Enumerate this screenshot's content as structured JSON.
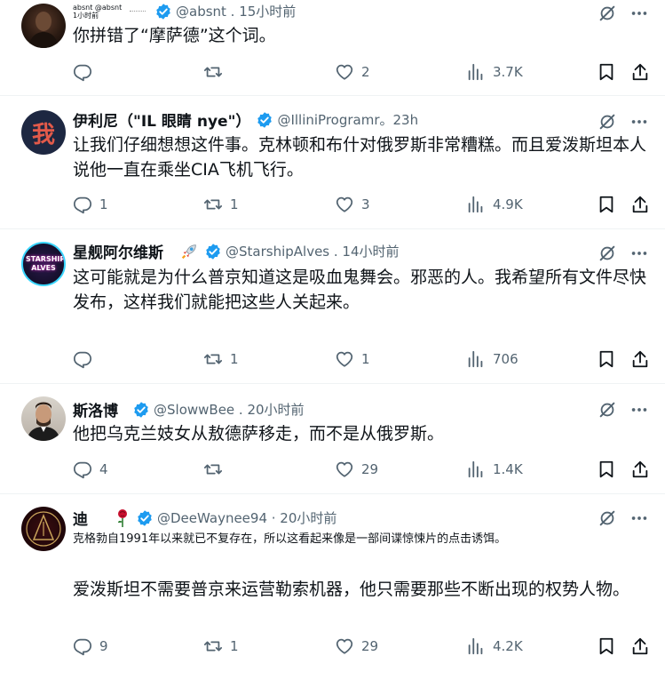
{
  "tweets": [
    {
      "name": "absnt @absnt 1小时前",
      "handle": "@absnt . 15小时前",
      "text": "你拼错了“摩萨德”这个词。",
      "replies": "",
      "retweets": "",
      "likes": "2",
      "views": "3.7K"
    },
    {
      "name": "伊利尼（\"IL 眼睛 nye\"）",
      "handle": "@IlliniProgramr。23h",
      "avatar_text": "我",
      "text": "让我们仔细想想这件事。克林顿和布什对俄罗斯非常糟糕。而且爱泼斯坦本人说他一直在乘坐CIA飞机飞行。",
      "replies": "1",
      "retweets": "1",
      "likes": "3",
      "views": "4.9K"
    },
    {
      "name": "星舰阿尔维斯",
      "handle": "@StarshipAlves . 14小时前",
      "avatar_text": "STARSHIP ALVES",
      "text": "这可能就是为什么普京知道这是吸血鬼舞会。邪恶的人。我希望所有文件尽快发布，这样我们就能把这些人关起来。",
      "replies": "",
      "retweets": "1",
      "likes": "1",
      "views": "706"
    },
    {
      "name": "斯洛博",
      "handle": "@SlowwBee . 20小时前",
      "text": "他把乌克兰妓女从敖德萨移走，而不是从俄罗斯。",
      "replies": "4",
      "retweets": "",
      "likes": "29",
      "views": "1.4K"
    },
    {
      "name": "迪",
      "handle": "@DeeWaynee94 · 20小时前",
      "text_small": "克格勃自1991年以来就已不复存在，所以这看起来像是一部间谍惊悚片的点击诱饵。",
      "text": "爱泼斯坦不需要普京来运营勒索机器，他只需要那些不断出现的权势人物。",
      "replies": "9",
      "retweets": "1",
      "likes": "29",
      "views": "4.2K"
    }
  ],
  "colors": {
    "verified": "#1d9bf0",
    "muted": "#536471",
    "text": "#0f1419"
  }
}
